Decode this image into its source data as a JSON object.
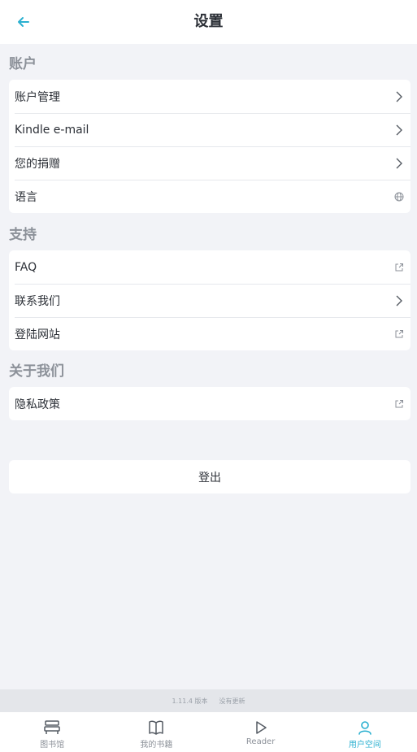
{
  "header": {
    "title": "设置"
  },
  "sections": [
    {
      "title": "账户",
      "items": [
        {
          "label": "账户管理",
          "trail": "chevron"
        },
        {
          "label": "Kindle e-mail",
          "trail": "chevron"
        },
        {
          "label": "您的捐赠",
          "trail": "chevron"
        },
        {
          "label": "语言",
          "trail": "globe"
        }
      ]
    },
    {
      "title": "支持",
      "items": [
        {
          "label": "FAQ",
          "trail": "external-link"
        },
        {
          "label": "联系我们",
          "trail": "chevron"
        },
        {
          "label": "登陆网站",
          "trail": "external-link"
        }
      ]
    },
    {
      "title": "关于我们",
      "items": [
        {
          "label": "隐私政策",
          "trail": "external-link"
        }
      ]
    }
  ],
  "logout_label": "登出",
  "footer": {
    "version": "1.11.4 版本",
    "history": "没有更新"
  },
  "tabs": [
    {
      "label": "图书馆",
      "icon": "library-icon",
      "active": false
    },
    {
      "label": "我的书籍",
      "icon": "book-icon",
      "active": false
    },
    {
      "label": "Reader",
      "icon": "play-icon",
      "active": false
    },
    {
      "label": "用户空间",
      "icon": "user-icon",
      "active": true
    }
  ],
  "colors": {
    "accent": "#2bb0d0",
    "background": "#f2f3f7",
    "muted": "#8c9199"
  }
}
